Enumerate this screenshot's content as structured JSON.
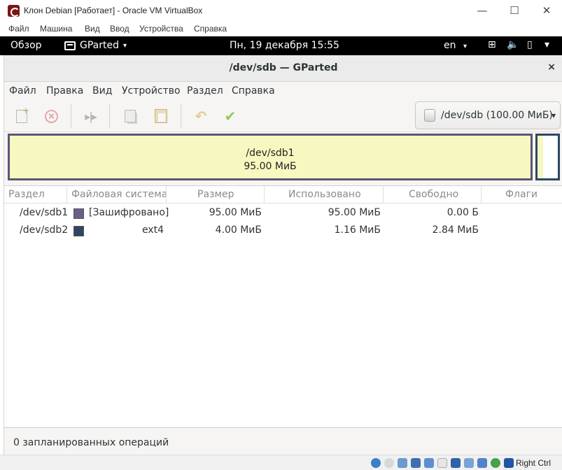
{
  "vbox": {
    "title": "Клон Debian [Работает] - Oracle VM VirtualBox",
    "controls": {
      "minimize": "—",
      "maximize": "☐",
      "close": "✕"
    },
    "menu": [
      "Файл",
      "Машина",
      "Вид",
      "Ввод",
      "Устройства",
      "Справка"
    ],
    "host_key": "Right Ctrl"
  },
  "gnome": {
    "overview": "Обзор",
    "app": "GParted",
    "clock": "Пн, 19 декабря  15:55",
    "lang": "en",
    "caret": "▾"
  },
  "gparted": {
    "title": "/dev/sdb — GParted",
    "close": "×",
    "menu": [
      "Файл",
      "Правка",
      "Вид",
      "Устройство",
      "Раздел",
      "Справка"
    ],
    "device": "/dev/sdb (100.00 МиБ)",
    "map": {
      "part1_name": "/dev/sdb1",
      "part1_size": "95.00 МиБ",
      "part1_color": "#5a5676",
      "part2_color": "#2e4662"
    },
    "columns": [
      "Раздел",
      "Файловая система",
      "Размер",
      "Использовано",
      "Свободно",
      "Флаги"
    ],
    "rows": [
      {
        "partition": "/dev/sdb1",
        "fs": "[Зашифровано]",
        "fs_color": "#6b5e8a",
        "size": "95.00 МиБ",
        "used": "95.00 МиБ",
        "free": "0.00 Б",
        "flags": ""
      },
      {
        "partition": "/dev/sdb2",
        "fs": "ext4",
        "fs_color": "#2e4662",
        "size": "4.00 МиБ",
        "used": "1.16 МиБ",
        "free": "2.84 МиБ",
        "flags": ""
      }
    ],
    "status": "0 запланированных операций"
  }
}
